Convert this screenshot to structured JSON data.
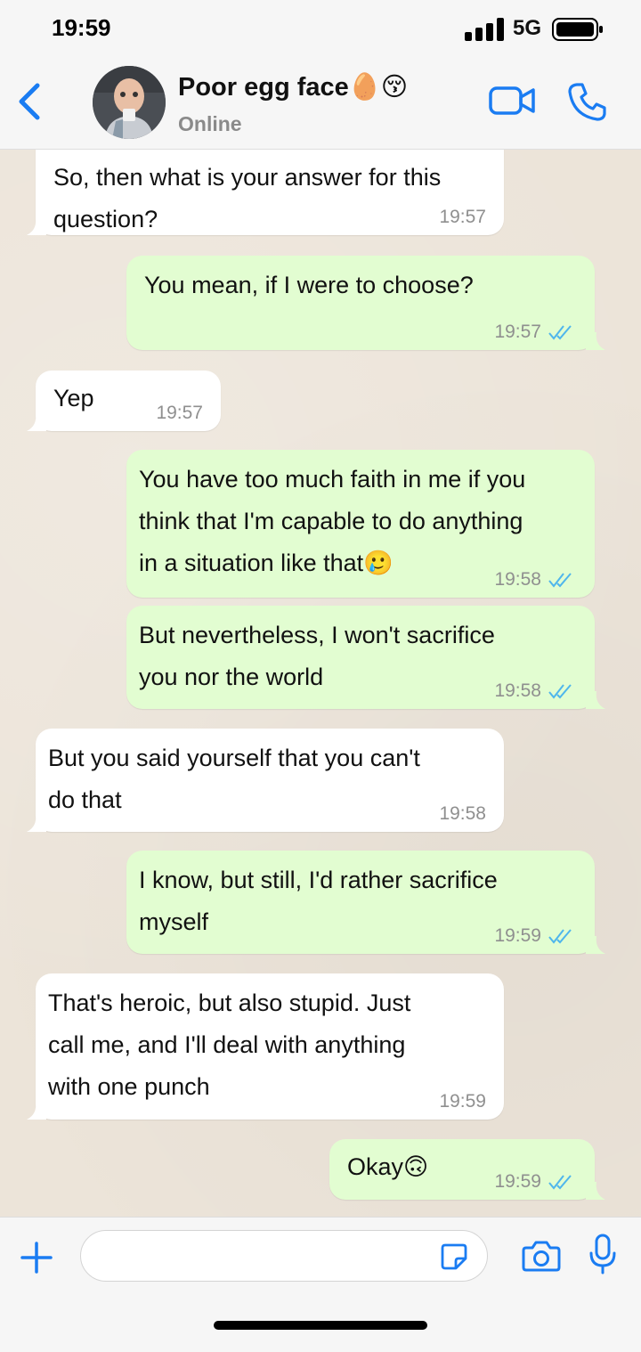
{
  "status_bar": {
    "time": "19:59",
    "network": "5G"
  },
  "header": {
    "contact_name": "Poor egg face🥚😚",
    "contact_status": "Online",
    "back_icon": "chevron-left-icon",
    "video_icon": "video-camera-icon",
    "call_icon": "phone-icon"
  },
  "messages": [
    {
      "direction": "in",
      "text": "So, then what is your answer for this\nquestion?",
      "time": "19:57"
    },
    {
      "direction": "out",
      "text": "You mean, if I were to choose?",
      "time": "19:57",
      "status": "read"
    },
    {
      "direction": "in",
      "text": "Yep",
      "time": "19:57"
    },
    {
      "direction": "out",
      "text": "You have too much faith in me if you\nthink that I'm capable to do anything\nin a situation like that🥲",
      "time": "19:58",
      "status": "read"
    },
    {
      "direction": "out",
      "text": "But nevertheless, I won't sacrifice\nyou nor the world",
      "time": "19:58",
      "status": "read"
    },
    {
      "direction": "in",
      "text": "But you said yourself that you can't\ndo that",
      "time": "19:58"
    },
    {
      "direction": "out",
      "text": "I know, but still, I'd rather sacrifice\nmyself",
      "time": "19:59",
      "status": "read"
    },
    {
      "direction": "in",
      "text": "That's heroic, but also stupid. Just\ncall me, and I'll deal with anything\nwith one punch",
      "time": "19:59"
    },
    {
      "direction": "out",
      "text": "Okay🙃",
      "time": "19:59",
      "status": "read"
    }
  ],
  "input_bar": {
    "message_value": "",
    "icons": [
      "plus-icon",
      "sticker-icon",
      "camera-icon",
      "microphone-icon"
    ]
  },
  "colors": {
    "accent": "#1a7cf2",
    "outgoing_bubble": "#e2fdd1",
    "incoming_bubble": "#ffffff",
    "read_ticks": "#4fb6ec"
  }
}
